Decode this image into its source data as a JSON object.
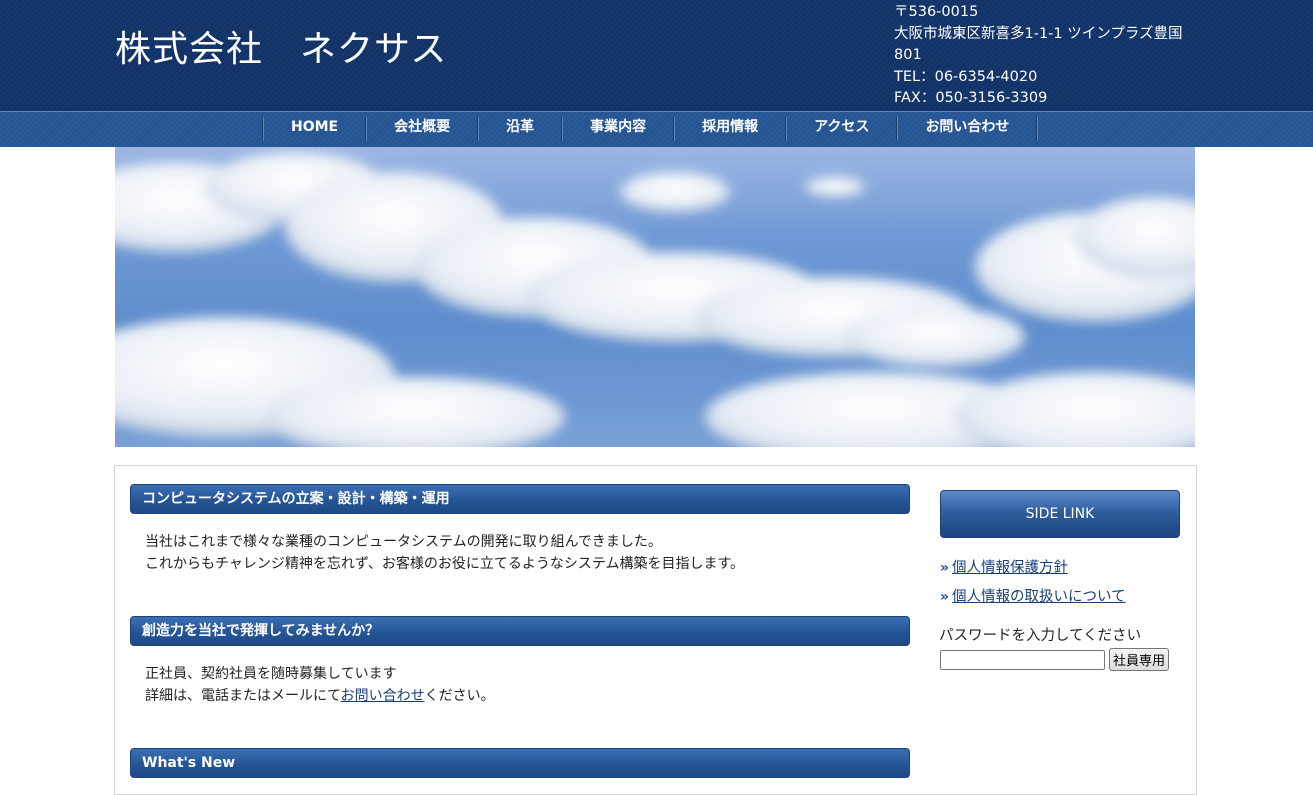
{
  "header": {
    "site_title": "株式会社　ネクサス",
    "address": {
      "postal": "〒536-0015",
      "street": "大阪市城東区新喜多1-1-1 ツインプラズ豊国",
      "room": "801",
      "tel": "TEL：06-6354-4020",
      "fax": "FAX：050-3156-3309"
    }
  },
  "nav": {
    "items": [
      {
        "label": "HOME"
      },
      {
        "label": "会社概要"
      },
      {
        "label": "沿革"
      },
      {
        "label": "事業内容"
      },
      {
        "label": "採用情報"
      },
      {
        "label": "アクセス"
      },
      {
        "label": "お問い合わせ"
      }
    ]
  },
  "main": {
    "section1": {
      "heading": "コンピュータシステムの立案・設計・構築・運用",
      "line1": "当社はこれまで様々な業種のコンピュータシステムの開発に取り組んできました。",
      "line2": "これからもチャレンジ精神を忘れず、お客様のお役に立てるようなシステム構築を目指します。"
    },
    "section2": {
      "heading": "創造力を当社で発揮してみませんか？",
      "line1": "正社員、契約社員を随時募集しています",
      "line2_prefix": "詳細は、電話またはメールにて",
      "line2_link": "お問い合わせ",
      "line2_suffix": "ください。"
    },
    "section3": {
      "heading": "What's New"
    }
  },
  "sidebar": {
    "heading": "SIDE LINK",
    "links": [
      {
        "label": "個人情報保護方針"
      },
      {
        "label": "個人情報の取扱いについて"
      }
    ],
    "password": {
      "label": "パスワードを入力してください",
      "value": "",
      "button": "社員専用"
    }
  },
  "colors": {
    "header_bg": "#16386c",
    "nav_bg": "#2a5a9c",
    "heading_bg": "#255596",
    "link": "#1a3f7a"
  }
}
